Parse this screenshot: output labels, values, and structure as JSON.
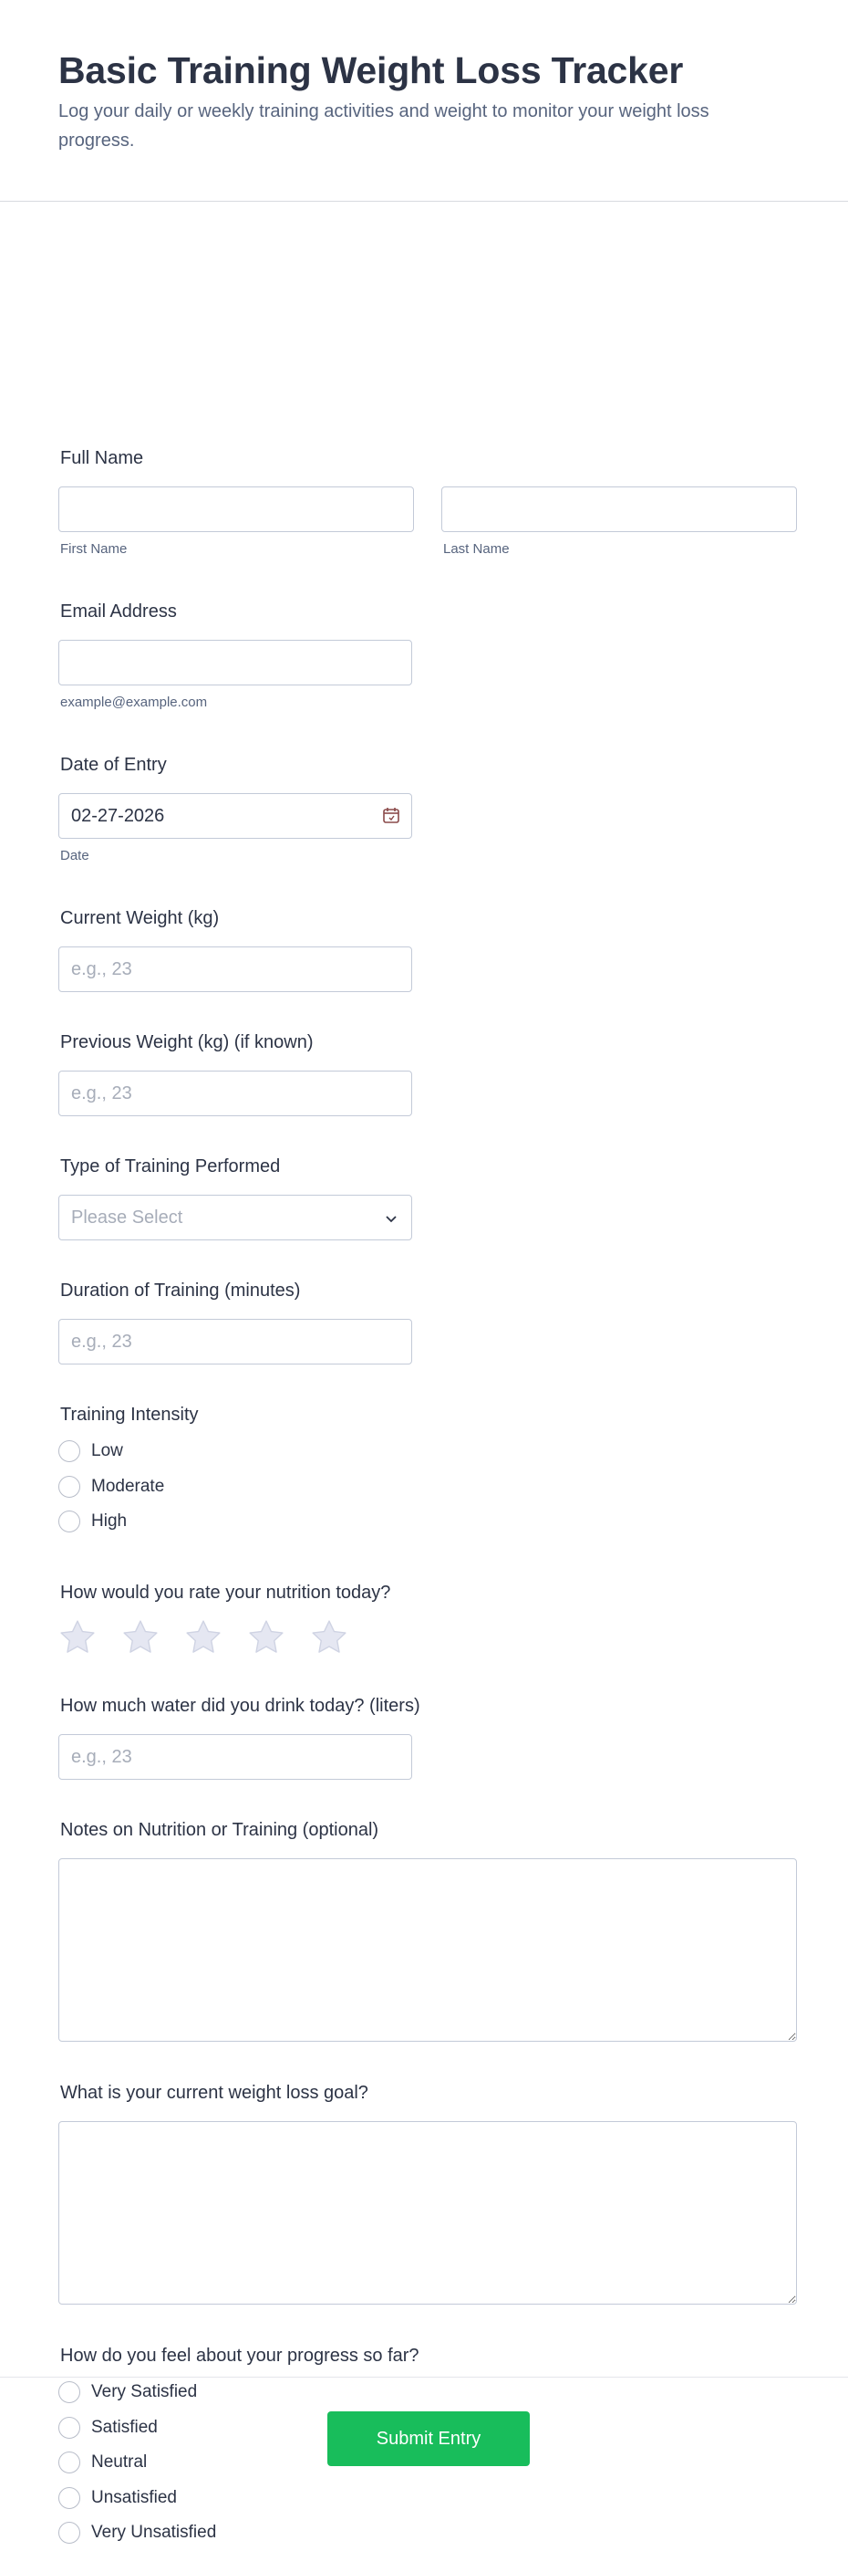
{
  "header": {
    "title": "Basic Training Weight Loss Tracker",
    "subtitle": "Log your daily or weekly training activities and weight to monitor your weight loss progress."
  },
  "full_name": {
    "label": "Full Name",
    "first_sublabel": "First Name",
    "last_sublabel": "Last Name"
  },
  "email": {
    "label": "Email Address",
    "sublabel": "example@example.com"
  },
  "date": {
    "label": "Date of Entry",
    "value": "02-27-2026",
    "sublabel": "Date",
    "icon": "calendar-icon"
  },
  "current_weight": {
    "label": "Current Weight (kg)",
    "placeholder": "e.g., 23"
  },
  "previous_weight": {
    "label": "Previous Weight (kg) (if known)",
    "placeholder": "e.g., 23"
  },
  "training_type": {
    "label": "Type of Training Performed",
    "selected": "Please Select",
    "icon": "chevron-down-icon"
  },
  "duration": {
    "label": "Duration of Training (minutes)",
    "placeholder": "e.g., 23"
  },
  "intensity": {
    "label": "Training Intensity",
    "options": [
      "Low",
      "Moderate",
      "High"
    ]
  },
  "nutrition_rating": {
    "label": "How would you rate your nutrition today?",
    "stars": 5,
    "rating": 0,
    "star_color": "#e5e7f2"
  },
  "water": {
    "label": "How much water did you drink today? (liters)",
    "placeholder": "e.g., 23"
  },
  "notes": {
    "label": "Notes on Nutrition or Training (optional)"
  },
  "goal": {
    "label": "What is your current weight loss goal?"
  },
  "progress_feeling": {
    "label": "How do you feel about your progress so far?",
    "options": [
      "Very Satisfied",
      "Satisfied",
      "Neutral",
      "Unsatisfied",
      "Very Unsatisfied"
    ]
  },
  "submit": {
    "label": "Submit Entry",
    "color": "#18bd5b"
  }
}
